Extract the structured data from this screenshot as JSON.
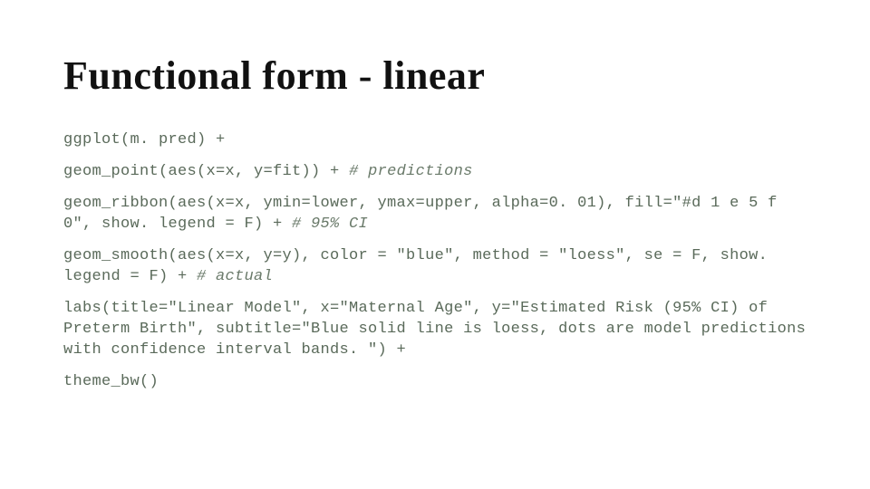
{
  "slide": {
    "title": "Functional form - linear",
    "code_lines": [
      {
        "code": "ggplot(m. pred) +",
        "comment": ""
      },
      {
        "code": "geom_point(aes(x=x, y=fit)) + ",
        "comment": "# predictions"
      },
      {
        "code": "geom_ribbon(aes(x=x, ymin=lower, ymax=upper, alpha=0. 01), fill=\"#d 1 e 5 f 0\", show. legend = F) + ",
        "comment": "# 95% CI"
      },
      {
        "code": "geom_smooth(aes(x=x, y=y), color = \"blue\", method = \"loess\", se = F, show. legend = F) + ",
        "comment": "# actual"
      },
      {
        "code": "labs(title=\"Linear Model\", x=\"Maternal Age\", y=\"Estimated Risk (95% CI) of Preterm Birth\", subtitle=\"Blue solid line is loess, dots are model predictions with confidence interval bands. \") +",
        "comment": ""
      },
      {
        "code": "theme_bw()",
        "comment": ""
      }
    ]
  }
}
